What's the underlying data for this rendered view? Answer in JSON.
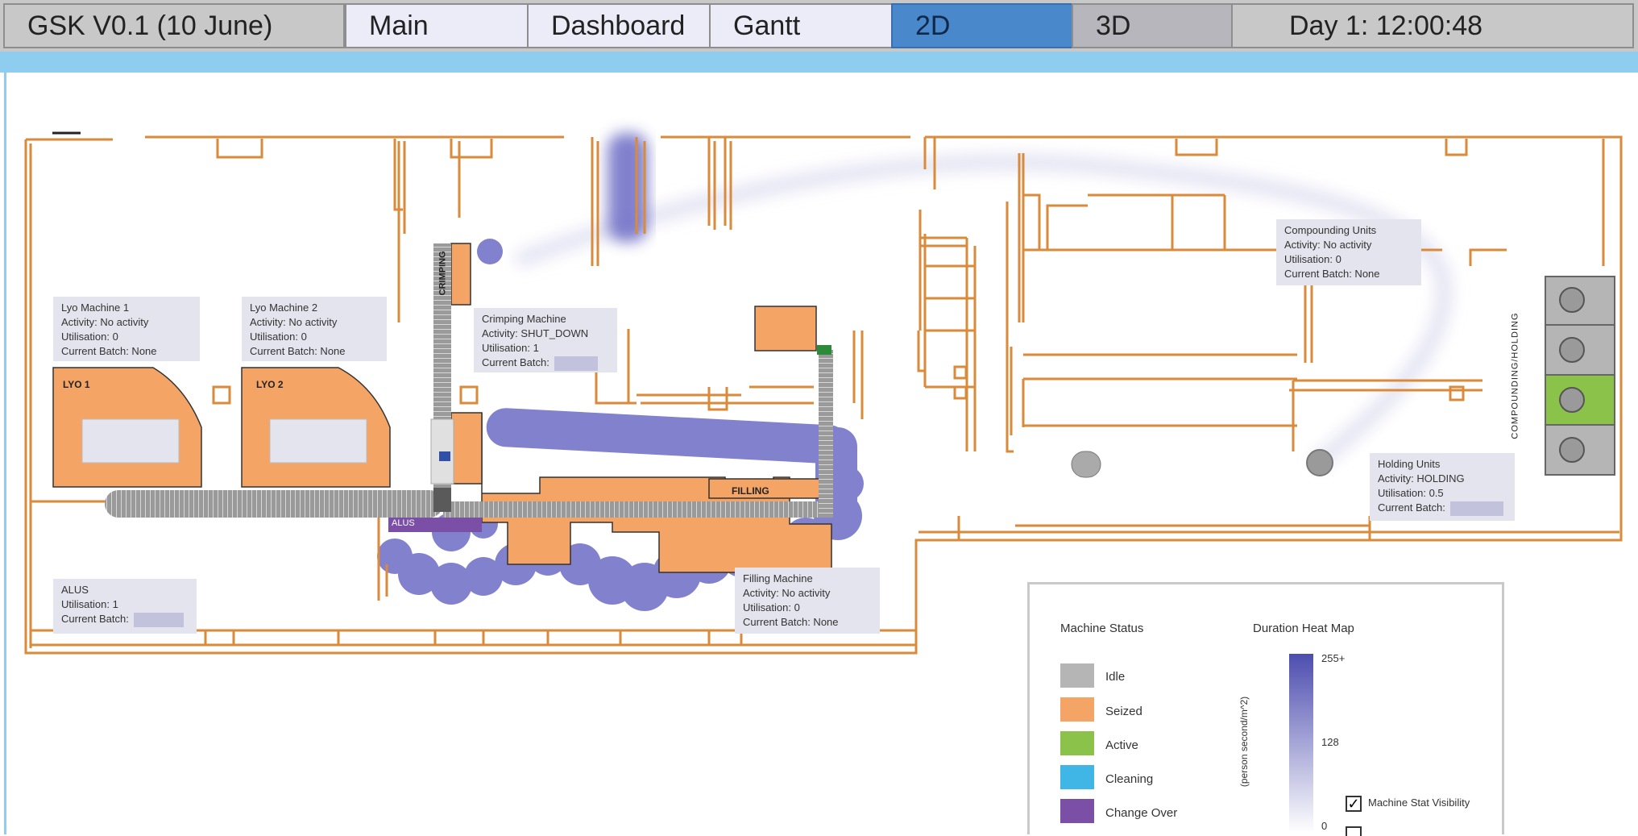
{
  "app_title": "GSK V0.1 (10 June)",
  "tabs": [
    {
      "label": "Main"
    },
    {
      "label": "Dashboard"
    },
    {
      "label": "Gantt"
    },
    {
      "label": "2D"
    },
    {
      "label": "3D"
    }
  ],
  "active_tab": "2D",
  "clock": "Day 1: 12:00:48",
  "colors": {
    "tab_active": "#4a88cc",
    "seized": "#f4a566",
    "idle": "#b5b5b5",
    "active": "#8bc34a",
    "cleaning": "#3fb6e6",
    "change_over": "#7b4fa6",
    "walls": "#d98a3a",
    "heat": "#5c5cb8"
  },
  "areas": {
    "lyo1": "LYO 1",
    "lyo2": "LYO 2",
    "crimping": "CRIMPING",
    "filling": "FILLING",
    "alus": "ALUS",
    "compounding_holding": "COMPOUNDING/HOLDING"
  },
  "machines": {
    "lyo1": {
      "title": "Lyo Machine 1",
      "activity": "Activity:  No activity",
      "utilisation": "Utilisation:  0",
      "batch": "Current Batch:  None"
    },
    "lyo2": {
      "title": "Lyo Machine 2",
      "activity": "Activity:  No activity",
      "utilisation": "Utilisation:  0",
      "batch": "Current Batch:  None"
    },
    "crimping": {
      "title": "Crimping Machine",
      "activity": "Activity:  SHUT_DOWN",
      "utilisation": "Utilisation:  1",
      "batch": "Current Batch:"
    },
    "compounding": {
      "title": "Compounding Units",
      "activity": "Activity:  No activity",
      "utilisation": "Utilisation:  0",
      "batch": "Current Batch:  None"
    },
    "holding": {
      "title": "Holding Units",
      "activity": "Activity:  HOLDING",
      "utilisation": "Utilisation:  0.5",
      "batch": "Current Batch:"
    },
    "filling": {
      "title": "Filling Machine",
      "activity": "Activity:  No activity",
      "utilisation": "Utilisation:  0",
      "batch": "Current Batch:  None"
    },
    "alus": {
      "title": "ALUS",
      "utilisation": "Utilisation:  1",
      "batch": "Current Batch:"
    }
  },
  "legend": {
    "machine_status_title": "Machine Status",
    "statuses": [
      {
        "label": "Idle",
        "color": "#b5b5b5"
      },
      {
        "label": "Seized",
        "color": "#f4a566"
      },
      {
        "label": "Active",
        "color": "#8bc34a"
      },
      {
        "label": "Cleaning",
        "color": "#3fb6e6"
      },
      {
        "label": "Change Over",
        "color": "#7b4fa6"
      }
    ],
    "heatmap_title": "Duration Heat Map",
    "heatmap_unit": "(person second/m^2)",
    "heatmap_max": "255+",
    "heatmap_mid": "128",
    "heatmap_min": "0",
    "checkbox_label": "Machine Stat Visibility",
    "checkbox_checked": true
  }
}
